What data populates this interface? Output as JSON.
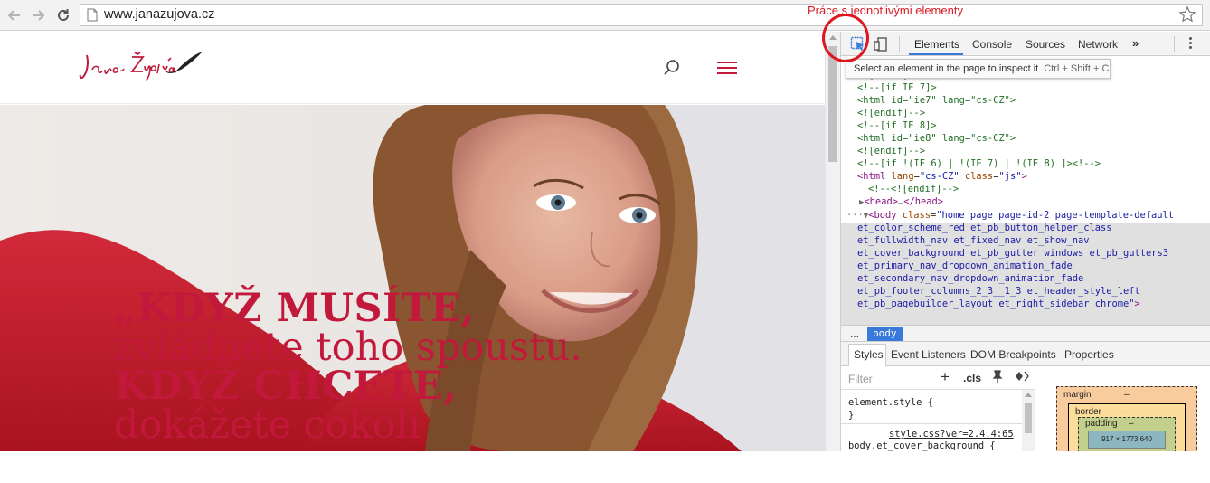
{
  "browser": {
    "url": "www.janazujova.cz",
    "annotation": "Práce s jednotlivými elementy"
  },
  "site": {
    "logo_text": "Jana Žujová",
    "hero_quote": {
      "line1": "„KDYŽ MUSÍTE,",
      "line2": "zvládnete toho spoustu.",
      "line3": "KDYŽ CHCETE,",
      "line4": "dokážete cokoli"
    }
  },
  "devtools": {
    "tabs": [
      {
        "label": "Elements",
        "active": true
      },
      {
        "label": "Console",
        "active": false
      },
      {
        "label": "Sources",
        "active": false
      },
      {
        "label": "Network",
        "active": false
      }
    ],
    "more_tabs": "»",
    "tooltip": {
      "text": "Select an element in the page to inspect it",
      "shortcut": "Ctrl + Shift + C"
    },
    "breadcrumb": {
      "ellipsis": "...",
      "current": "body"
    },
    "styles_tabs": [
      "Styles",
      "Event Listeners",
      "DOM Breakpoints",
      "Properties"
    ],
    "filter_placeholder": "Filter",
    "cls_label": ".cls",
    "element_style": "element.style {",
    "close_brace": "}",
    "style_link": "style.css?ver=2.4.4:65",
    "rule_selector": "body.et_cover_background {",
    "box_model": {
      "margin_label": "margin",
      "margin_value": "–",
      "border_label": "border",
      "border_value": "–",
      "padding_label": "padding",
      "padding_value": "–",
      "content_value": "917 × 1773.640"
    }
  },
  "colors": {
    "brand": "#c2183b",
    "annotation_red": "#d81a24",
    "devtools_accent": "#3879d9"
  }
}
